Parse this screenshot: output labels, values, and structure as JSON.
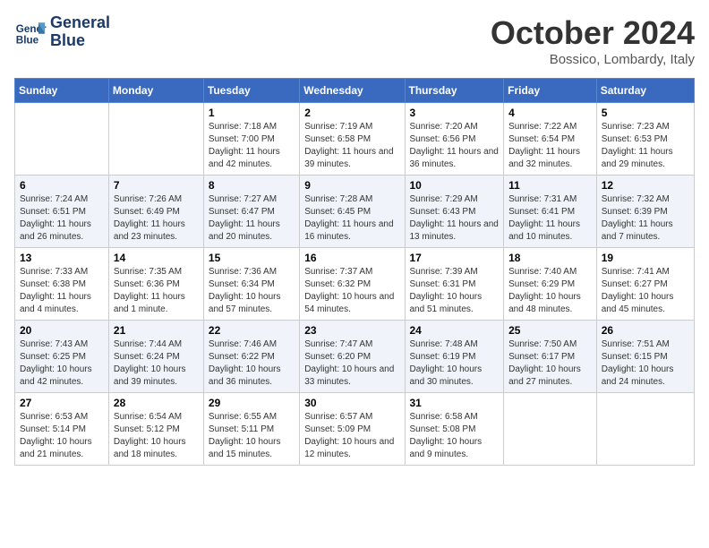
{
  "logo": {
    "line1": "General",
    "line2": "Blue"
  },
  "title": "October 2024",
  "location": "Bossico, Lombardy, Italy",
  "days_header": [
    "Sunday",
    "Monday",
    "Tuesday",
    "Wednesday",
    "Thursday",
    "Friday",
    "Saturday"
  ],
  "weeks": [
    [
      {
        "day": "",
        "info": ""
      },
      {
        "day": "",
        "info": ""
      },
      {
        "day": "1",
        "info": "Sunrise: 7:18 AM\nSunset: 7:00 PM\nDaylight: 11 hours and 42 minutes."
      },
      {
        "day": "2",
        "info": "Sunrise: 7:19 AM\nSunset: 6:58 PM\nDaylight: 11 hours and 39 minutes."
      },
      {
        "day": "3",
        "info": "Sunrise: 7:20 AM\nSunset: 6:56 PM\nDaylight: 11 hours and 36 minutes."
      },
      {
        "day": "4",
        "info": "Sunrise: 7:22 AM\nSunset: 6:54 PM\nDaylight: 11 hours and 32 minutes."
      },
      {
        "day": "5",
        "info": "Sunrise: 7:23 AM\nSunset: 6:53 PM\nDaylight: 11 hours and 29 minutes."
      }
    ],
    [
      {
        "day": "6",
        "info": "Sunrise: 7:24 AM\nSunset: 6:51 PM\nDaylight: 11 hours and 26 minutes."
      },
      {
        "day": "7",
        "info": "Sunrise: 7:26 AM\nSunset: 6:49 PM\nDaylight: 11 hours and 23 minutes."
      },
      {
        "day": "8",
        "info": "Sunrise: 7:27 AM\nSunset: 6:47 PM\nDaylight: 11 hours and 20 minutes."
      },
      {
        "day": "9",
        "info": "Sunrise: 7:28 AM\nSunset: 6:45 PM\nDaylight: 11 hours and 16 minutes."
      },
      {
        "day": "10",
        "info": "Sunrise: 7:29 AM\nSunset: 6:43 PM\nDaylight: 11 hours and 13 minutes."
      },
      {
        "day": "11",
        "info": "Sunrise: 7:31 AM\nSunset: 6:41 PM\nDaylight: 11 hours and 10 minutes."
      },
      {
        "day": "12",
        "info": "Sunrise: 7:32 AM\nSunset: 6:39 PM\nDaylight: 11 hours and 7 minutes."
      }
    ],
    [
      {
        "day": "13",
        "info": "Sunrise: 7:33 AM\nSunset: 6:38 PM\nDaylight: 11 hours and 4 minutes."
      },
      {
        "day": "14",
        "info": "Sunrise: 7:35 AM\nSunset: 6:36 PM\nDaylight: 11 hours and 1 minute."
      },
      {
        "day": "15",
        "info": "Sunrise: 7:36 AM\nSunset: 6:34 PM\nDaylight: 10 hours and 57 minutes."
      },
      {
        "day": "16",
        "info": "Sunrise: 7:37 AM\nSunset: 6:32 PM\nDaylight: 10 hours and 54 minutes."
      },
      {
        "day": "17",
        "info": "Sunrise: 7:39 AM\nSunset: 6:31 PM\nDaylight: 10 hours and 51 minutes."
      },
      {
        "day": "18",
        "info": "Sunrise: 7:40 AM\nSunset: 6:29 PM\nDaylight: 10 hours and 48 minutes."
      },
      {
        "day": "19",
        "info": "Sunrise: 7:41 AM\nSunset: 6:27 PM\nDaylight: 10 hours and 45 minutes."
      }
    ],
    [
      {
        "day": "20",
        "info": "Sunrise: 7:43 AM\nSunset: 6:25 PM\nDaylight: 10 hours and 42 minutes."
      },
      {
        "day": "21",
        "info": "Sunrise: 7:44 AM\nSunset: 6:24 PM\nDaylight: 10 hours and 39 minutes."
      },
      {
        "day": "22",
        "info": "Sunrise: 7:46 AM\nSunset: 6:22 PM\nDaylight: 10 hours and 36 minutes."
      },
      {
        "day": "23",
        "info": "Sunrise: 7:47 AM\nSunset: 6:20 PM\nDaylight: 10 hours and 33 minutes."
      },
      {
        "day": "24",
        "info": "Sunrise: 7:48 AM\nSunset: 6:19 PM\nDaylight: 10 hours and 30 minutes."
      },
      {
        "day": "25",
        "info": "Sunrise: 7:50 AM\nSunset: 6:17 PM\nDaylight: 10 hours and 27 minutes."
      },
      {
        "day": "26",
        "info": "Sunrise: 7:51 AM\nSunset: 6:15 PM\nDaylight: 10 hours and 24 minutes."
      }
    ],
    [
      {
        "day": "27",
        "info": "Sunrise: 6:53 AM\nSunset: 5:14 PM\nDaylight: 10 hours and 21 minutes."
      },
      {
        "day": "28",
        "info": "Sunrise: 6:54 AM\nSunset: 5:12 PM\nDaylight: 10 hours and 18 minutes."
      },
      {
        "day": "29",
        "info": "Sunrise: 6:55 AM\nSunset: 5:11 PM\nDaylight: 10 hours and 15 minutes."
      },
      {
        "day": "30",
        "info": "Sunrise: 6:57 AM\nSunset: 5:09 PM\nDaylight: 10 hours and 12 minutes."
      },
      {
        "day": "31",
        "info": "Sunrise: 6:58 AM\nSunset: 5:08 PM\nDaylight: 10 hours and 9 minutes."
      },
      {
        "day": "",
        "info": ""
      },
      {
        "day": "",
        "info": ""
      }
    ]
  ]
}
